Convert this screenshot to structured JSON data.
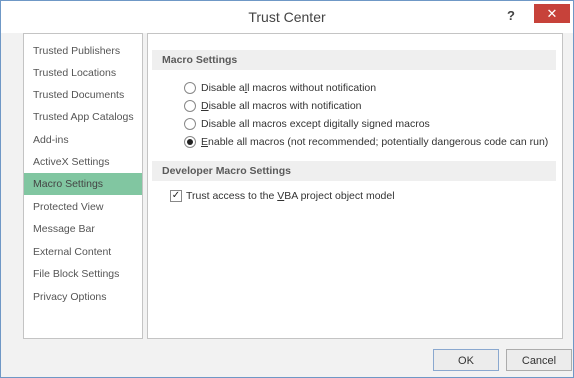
{
  "window": {
    "title": "Trust Center",
    "help_label": "?",
    "close_label": "✕"
  },
  "sidebar": {
    "items": [
      {
        "label": "Trusted Publishers",
        "selected": false
      },
      {
        "label": "Trusted Locations",
        "selected": false
      },
      {
        "label": "Trusted Documents",
        "selected": false
      },
      {
        "label": "Trusted App Catalogs",
        "selected": false
      },
      {
        "label": "Add-ins",
        "selected": false
      },
      {
        "label": "ActiveX Settings",
        "selected": false
      },
      {
        "label": "Macro Settings",
        "selected": true
      },
      {
        "label": "Protected View",
        "selected": false
      },
      {
        "label": "Message Bar",
        "selected": false
      },
      {
        "label": "External Content",
        "selected": false
      },
      {
        "label": "File Block Settings",
        "selected": false
      },
      {
        "label": "Privacy Options",
        "selected": false
      }
    ]
  },
  "macro_settings": {
    "header": "Macro Settings",
    "options": [
      {
        "pre": "Disable a",
        "key": "l",
        "post": "l macros without notification",
        "selected": false
      },
      {
        "pre": "",
        "key": "D",
        "post": "isable all macros with notification",
        "selected": false
      },
      {
        "pre": "Disable all macros except di",
        "key": "g",
        "post": "itally signed macros",
        "selected": false
      },
      {
        "pre": "",
        "key": "E",
        "post": "nable all macros (not recommended; potentially dangerous code can run)",
        "selected": true
      }
    ]
  },
  "developer_settings": {
    "header": "Developer Macro Settings",
    "checkbox": {
      "pre": "Trust access to the ",
      "key": "V",
      "post": "BA project object model",
      "checked": true,
      "check_glyph": "✓"
    }
  },
  "footer": {
    "ok_label": "OK",
    "cancel_label": "Cancel"
  },
  "colors": {
    "close_button": "#c7423a",
    "selected_nav": "#81c6a1",
    "dialog_border": "#6f98c6"
  }
}
